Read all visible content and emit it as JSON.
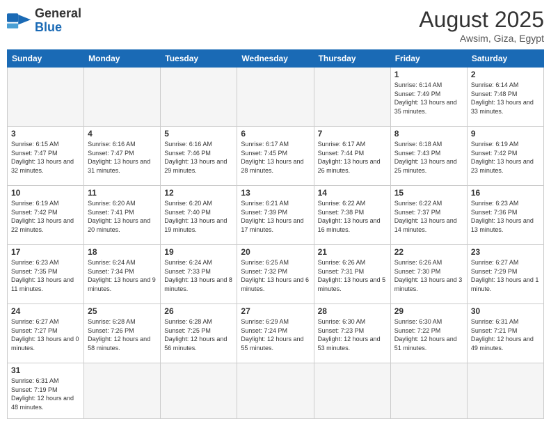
{
  "header": {
    "logo_general": "General",
    "logo_blue": "Blue",
    "title_month": "August 2025",
    "title_location": "Awsim, Giza, Egypt"
  },
  "weekdays": [
    "Sunday",
    "Monday",
    "Tuesday",
    "Wednesday",
    "Thursday",
    "Friday",
    "Saturday"
  ],
  "weeks": [
    [
      {
        "day": "",
        "info": ""
      },
      {
        "day": "",
        "info": ""
      },
      {
        "day": "",
        "info": ""
      },
      {
        "day": "",
        "info": ""
      },
      {
        "day": "",
        "info": ""
      },
      {
        "day": "1",
        "info": "Sunrise: 6:14 AM\nSunset: 7:49 PM\nDaylight: 13 hours and 35 minutes."
      },
      {
        "day": "2",
        "info": "Sunrise: 6:14 AM\nSunset: 7:48 PM\nDaylight: 13 hours and 33 minutes."
      }
    ],
    [
      {
        "day": "3",
        "info": "Sunrise: 6:15 AM\nSunset: 7:47 PM\nDaylight: 13 hours and 32 minutes."
      },
      {
        "day": "4",
        "info": "Sunrise: 6:16 AM\nSunset: 7:47 PM\nDaylight: 13 hours and 31 minutes."
      },
      {
        "day": "5",
        "info": "Sunrise: 6:16 AM\nSunset: 7:46 PM\nDaylight: 13 hours and 29 minutes."
      },
      {
        "day": "6",
        "info": "Sunrise: 6:17 AM\nSunset: 7:45 PM\nDaylight: 13 hours and 28 minutes."
      },
      {
        "day": "7",
        "info": "Sunrise: 6:17 AM\nSunset: 7:44 PM\nDaylight: 13 hours and 26 minutes."
      },
      {
        "day": "8",
        "info": "Sunrise: 6:18 AM\nSunset: 7:43 PM\nDaylight: 13 hours and 25 minutes."
      },
      {
        "day": "9",
        "info": "Sunrise: 6:19 AM\nSunset: 7:42 PM\nDaylight: 13 hours and 23 minutes."
      }
    ],
    [
      {
        "day": "10",
        "info": "Sunrise: 6:19 AM\nSunset: 7:42 PM\nDaylight: 13 hours and 22 minutes."
      },
      {
        "day": "11",
        "info": "Sunrise: 6:20 AM\nSunset: 7:41 PM\nDaylight: 13 hours and 20 minutes."
      },
      {
        "day": "12",
        "info": "Sunrise: 6:20 AM\nSunset: 7:40 PM\nDaylight: 13 hours and 19 minutes."
      },
      {
        "day": "13",
        "info": "Sunrise: 6:21 AM\nSunset: 7:39 PM\nDaylight: 13 hours and 17 minutes."
      },
      {
        "day": "14",
        "info": "Sunrise: 6:22 AM\nSunset: 7:38 PM\nDaylight: 13 hours and 16 minutes."
      },
      {
        "day": "15",
        "info": "Sunrise: 6:22 AM\nSunset: 7:37 PM\nDaylight: 13 hours and 14 minutes."
      },
      {
        "day": "16",
        "info": "Sunrise: 6:23 AM\nSunset: 7:36 PM\nDaylight: 13 hours and 13 minutes."
      }
    ],
    [
      {
        "day": "17",
        "info": "Sunrise: 6:23 AM\nSunset: 7:35 PM\nDaylight: 13 hours and 11 minutes."
      },
      {
        "day": "18",
        "info": "Sunrise: 6:24 AM\nSunset: 7:34 PM\nDaylight: 13 hours and 9 minutes."
      },
      {
        "day": "19",
        "info": "Sunrise: 6:24 AM\nSunset: 7:33 PM\nDaylight: 13 hours and 8 minutes."
      },
      {
        "day": "20",
        "info": "Sunrise: 6:25 AM\nSunset: 7:32 PM\nDaylight: 13 hours and 6 minutes."
      },
      {
        "day": "21",
        "info": "Sunrise: 6:26 AM\nSunset: 7:31 PM\nDaylight: 13 hours and 5 minutes."
      },
      {
        "day": "22",
        "info": "Sunrise: 6:26 AM\nSunset: 7:30 PM\nDaylight: 13 hours and 3 minutes."
      },
      {
        "day": "23",
        "info": "Sunrise: 6:27 AM\nSunset: 7:29 PM\nDaylight: 13 hours and 1 minute."
      }
    ],
    [
      {
        "day": "24",
        "info": "Sunrise: 6:27 AM\nSunset: 7:27 PM\nDaylight: 13 hours and 0 minutes."
      },
      {
        "day": "25",
        "info": "Sunrise: 6:28 AM\nSunset: 7:26 PM\nDaylight: 12 hours and 58 minutes."
      },
      {
        "day": "26",
        "info": "Sunrise: 6:28 AM\nSunset: 7:25 PM\nDaylight: 12 hours and 56 minutes."
      },
      {
        "day": "27",
        "info": "Sunrise: 6:29 AM\nSunset: 7:24 PM\nDaylight: 12 hours and 55 minutes."
      },
      {
        "day": "28",
        "info": "Sunrise: 6:30 AM\nSunset: 7:23 PM\nDaylight: 12 hours and 53 minutes."
      },
      {
        "day": "29",
        "info": "Sunrise: 6:30 AM\nSunset: 7:22 PM\nDaylight: 12 hours and 51 minutes."
      },
      {
        "day": "30",
        "info": "Sunrise: 6:31 AM\nSunset: 7:21 PM\nDaylight: 12 hours and 49 minutes."
      }
    ],
    [
      {
        "day": "31",
        "info": "Sunrise: 6:31 AM\nSunset: 7:19 PM\nDaylight: 12 hours and 48 minutes."
      },
      {
        "day": "",
        "info": ""
      },
      {
        "day": "",
        "info": ""
      },
      {
        "day": "",
        "info": ""
      },
      {
        "day": "",
        "info": ""
      },
      {
        "day": "",
        "info": ""
      },
      {
        "day": "",
        "info": ""
      }
    ]
  ]
}
